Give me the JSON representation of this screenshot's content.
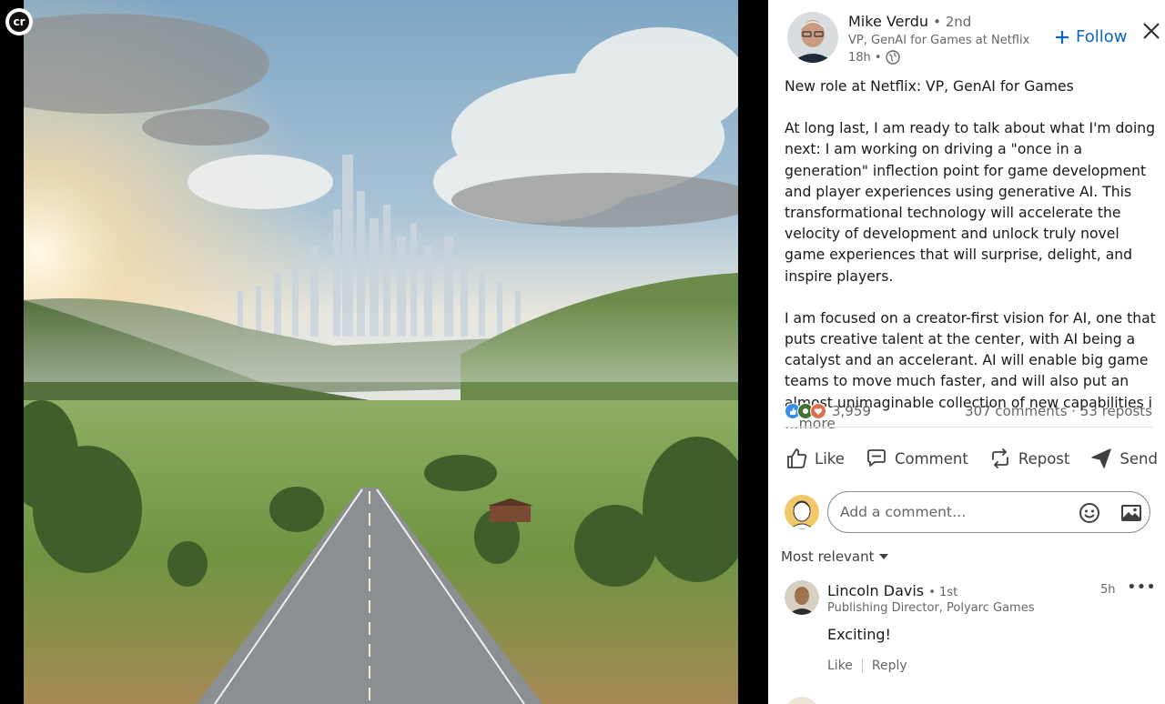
{
  "brand_badge": "cr",
  "author": {
    "name": "Mike Verdu",
    "degree": "• 2nd",
    "headline": "VP, GenAI for Games at Netflix",
    "time": "18h •",
    "follow_label": "Follow"
  },
  "post": {
    "paragraphs": [
      "New role at Netflix: VP, GenAI for Games",
      "At long last, I am ready to talk about what I'm doing next: I am working on driving a \"once in a generation\" inflection point for game development and player experiences using generative AI. This transformational technology will accelerate the velocity of development and unlock truly novel game experiences that will surprise, delight, and inspire players.",
      "I am focused on a creator-first vision for AI, one that puts creative talent at the center, with AI being a catalyst and an accelerant. AI will enable big game teams to move much faster, and will also put an almost unimaginable collection of new capabilities i"
    ],
    "more_label": "…more"
  },
  "social": {
    "reaction_count": "3,959",
    "comments": "307 comments",
    "separator": "·",
    "reposts": "53 reposts"
  },
  "actions": {
    "like": "Like",
    "comment": "Comment",
    "repost": "Repost",
    "send": "Send"
  },
  "comment_input": {
    "placeholder": "Add a comment…"
  },
  "sort_label": "Most relevant",
  "comment": {
    "name": "Lincoln Davis",
    "degree": "• 1st",
    "headline": "Publishing Director, Polyarc Games",
    "time": "5h",
    "more": "•••",
    "body": "Exciting!",
    "like_label": "Like",
    "reply_label": "Reply"
  },
  "colors": {
    "accent": "#0a66c2",
    "muted_text": "#666666",
    "text": "#191919",
    "background_dark": "#000000"
  }
}
